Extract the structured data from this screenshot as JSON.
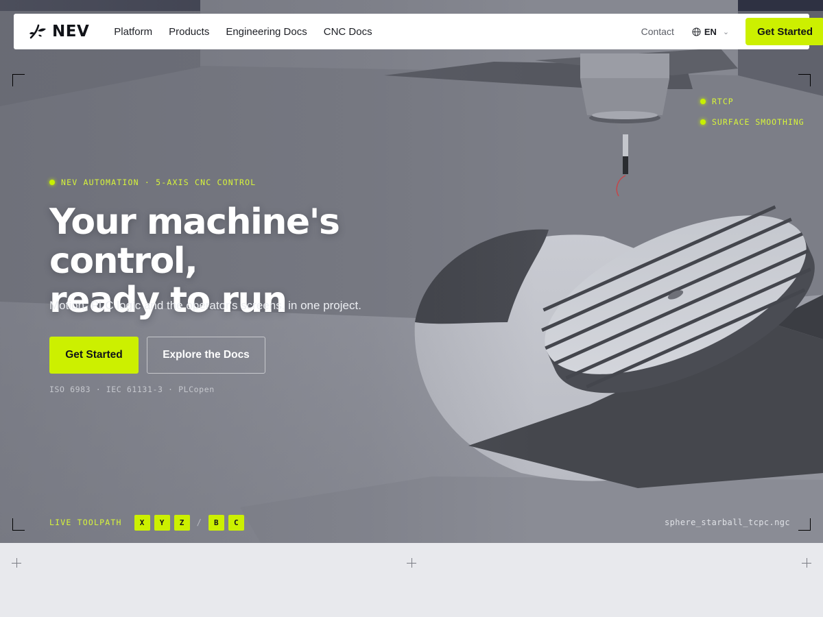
{
  "nav": {
    "logo_text": "NEV",
    "links": [
      "Platform",
      "Products",
      "Engineering Docs",
      "CNC Docs"
    ],
    "contact": "Contact",
    "language": "EN",
    "cta": "Get Started"
  },
  "features": [
    "RTCP",
    "SURFACE SMOOTHING"
  ],
  "hero": {
    "eyebrow": "NEV AUTOMATION · 5-AXIS CNC CONTROL",
    "headline_line1": "Your machine's control,",
    "headline_line2": "ready to run",
    "subhead": "Motion, PLC logic and the operator's screens, in one project.",
    "primary_cta": "Get Started",
    "secondary_cta": "Explore the Docs",
    "standards": "ISO 6983 · IEC 61131-3 · PLCopen"
  },
  "toolpath": {
    "label": "LIVE TOOLPATH",
    "linear_axes": [
      "X",
      "Y",
      "Z"
    ],
    "separator": "/",
    "rotary_axes": [
      "B",
      "C"
    ],
    "filename": "sphere_starball_tcpc.ngc"
  },
  "colors": {
    "accent": "#ccf000",
    "scene_background": "#7b7d86",
    "lower_background": "#e8e9ed",
    "nav_background": "#ffffff"
  },
  "icons": {
    "logo": "leaf-sprout-icon",
    "language": "globe-icon",
    "dropdown": "chevron-down-icon"
  }
}
